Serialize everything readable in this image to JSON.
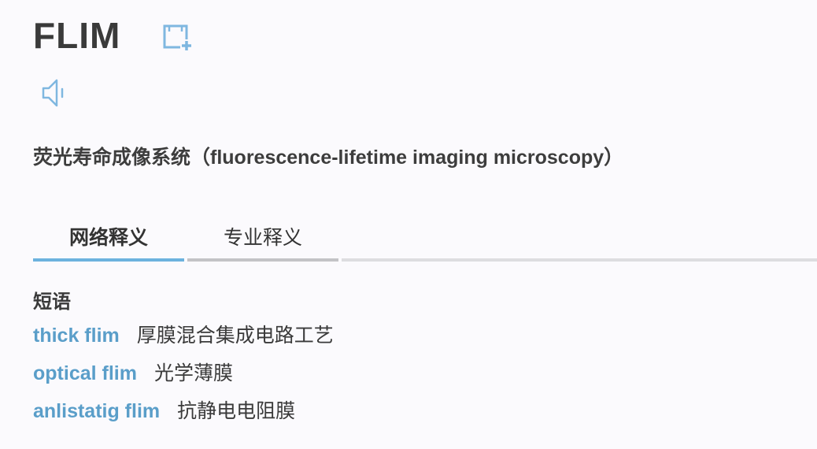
{
  "word": {
    "title": "FLIM",
    "definition": "荧光寿命成像系统（fluorescence-lifetime imaging microscopy）"
  },
  "icons": {
    "add_wordbook": "add-to-wordbook-icon",
    "pronounce": "speaker-icon"
  },
  "colors": {
    "accent": "#6cb2de",
    "link": "#5a9ec9",
    "icon": "#7fb7e0"
  },
  "tabs": [
    {
      "label": "网络释义",
      "active": true
    },
    {
      "label": "专业释义",
      "active": false
    }
  ],
  "phrases": {
    "heading": "短语",
    "items": [
      {
        "term": "thick flim",
        "translation": "厚膜混合集成电路工艺"
      },
      {
        "term": "optical flim",
        "translation": "光学薄膜"
      },
      {
        "term": "anlistatig flim",
        "translation": "抗静电电阻膜"
      }
    ]
  }
}
